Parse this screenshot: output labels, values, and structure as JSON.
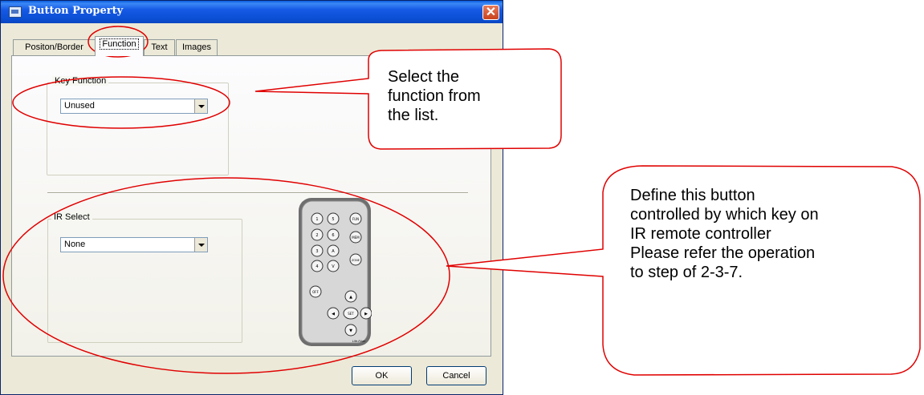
{
  "window": {
    "title": "Button Property"
  },
  "tabs": [
    {
      "label": "Positon/Border"
    },
    {
      "label": "Function"
    },
    {
      "label": "Text"
    },
    {
      "label": "Images"
    }
  ],
  "key_function": {
    "group_label": "Key Function",
    "value": "Unused"
  },
  "ir_select": {
    "group_label": "IR Select",
    "value": "None"
  },
  "remote": {
    "buttons": [
      "1",
      "2",
      "3",
      "4",
      "5",
      "6",
      "A",
      "V",
      "FUN",
      "MEM",
      "ZONE",
      "OFF",
      "SET"
    ],
    "brand": "Life-Fiber"
  },
  "footer": {
    "ok_label": "OK",
    "cancel_label": "Cancel"
  },
  "callouts": {
    "function_note": [
      "Select the",
      "function from",
      "the list."
    ],
    "ir_note": [
      "Define this button",
      "controlled by which key on",
      "IR remote controller",
      "Please refer the operation",
      "to step of 2-3-7."
    ]
  },
  "colors": {
    "titlebar": "#0a4fd4",
    "annotation": "#e00000",
    "dialog": "#ece9d8"
  }
}
